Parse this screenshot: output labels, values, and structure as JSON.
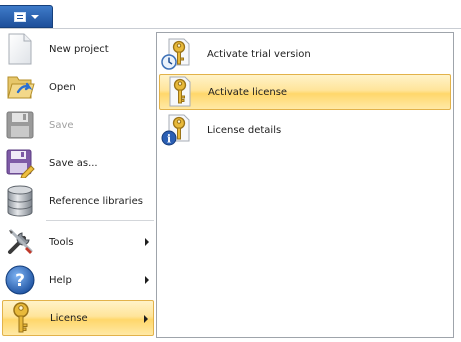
{
  "app_button": {
    "icon": "document-icon"
  },
  "main_menu": {
    "items": [
      {
        "label": "New project",
        "icon": "new-document-icon",
        "enabled": true
      },
      {
        "label": "Open",
        "icon": "open-folder-icon",
        "enabled": true
      },
      {
        "label": "Save",
        "icon": "floppy-disk-icon",
        "enabled": false
      },
      {
        "label": "Save as...",
        "icon": "save-as-icon",
        "enabled": true
      },
      {
        "label": "Reference libraries",
        "icon": "database-icon",
        "enabled": true
      },
      {
        "label": "Tools",
        "icon": "tools-icon",
        "enabled": true,
        "submenu": true
      },
      {
        "label": "Help",
        "icon": "help-icon",
        "enabled": true,
        "submenu": true
      },
      {
        "label": "License",
        "icon": "key-icon",
        "enabled": true,
        "submenu": true,
        "active": true
      }
    ]
  },
  "license_submenu": {
    "items": [
      {
        "label": "Activate trial version",
        "icon": "key-clock-icon"
      },
      {
        "label": "Activate license",
        "icon": "key-icon",
        "active": true
      },
      {
        "label": "License details",
        "icon": "info-icon"
      }
    ]
  },
  "colors": {
    "highlight": "#ffe49a",
    "highlight_border": "#e2b24a",
    "app_button": "#2a62b3"
  }
}
